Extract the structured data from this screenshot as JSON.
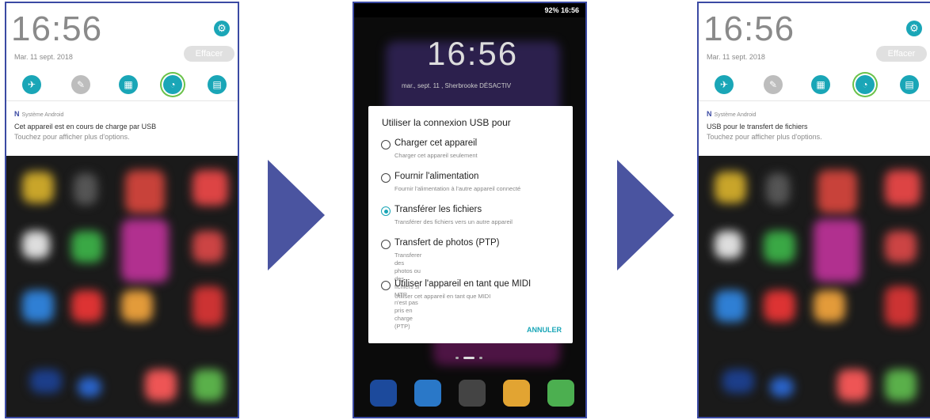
{
  "panels": [
    {
      "time": "16:56",
      "date": "Mar. 11 sept. 2018",
      "clear_label": "Effacer",
      "notif_source": "Système Android",
      "notif_line1": "Cet appareil est en cours de charge par USB",
      "notif_line2": "Touchez pour afficher plus d'options."
    },
    {
      "status": "92% 16:56",
      "time": "16:56",
      "date_line": "mar., sept. 11 , Sherbrooke  DÉSACTIV",
      "dialog_title": "Utiliser la connexion USB pour",
      "options": [
        {
          "label": "Charger cet appareil",
          "desc": "Charger cet appareil seulement",
          "selected": false
        },
        {
          "label": "Fournir l'alimentation",
          "desc": "Fournir l'alimentation à l'autre appareil connecté",
          "selected": false
        },
        {
          "label": "Transférer les fichiers",
          "desc": "Transférer des fichiers vers un autre appareil",
          "selected": true
        },
        {
          "label": "Transfert de photos (PTP)",
          "desc": "Transferer des photos ou des fichiers si MTP\nn'est pas pris en charge (PTP)",
          "selected": false
        },
        {
          "label": "Utiliser l'appareil en tant que MIDI",
          "desc": "Utiliser cet appareil en tant que MIDI",
          "selected": false
        }
      ],
      "cancel_label": "ANNULER"
    },
    {
      "time": "16:56",
      "date": "Mar. 11 sept. 2018",
      "clear_label": "Effacer",
      "notif_source": "Système Android",
      "notif_line1": "USB pour le transfert de fichiers",
      "notif_line2": "Touchez pour afficher plus d'options."
    }
  ],
  "icons": {
    "settings": "gear-icon",
    "quick_settings": [
      "airplane-icon",
      "flashlight-icon",
      "qr-scanner-icon",
      "data-usage-icon",
      "calculator-icon"
    ]
  },
  "colors": {
    "accent": "#1aa6b7",
    "frame": "#3b4aa3",
    "arrow": "#4a54a0"
  }
}
